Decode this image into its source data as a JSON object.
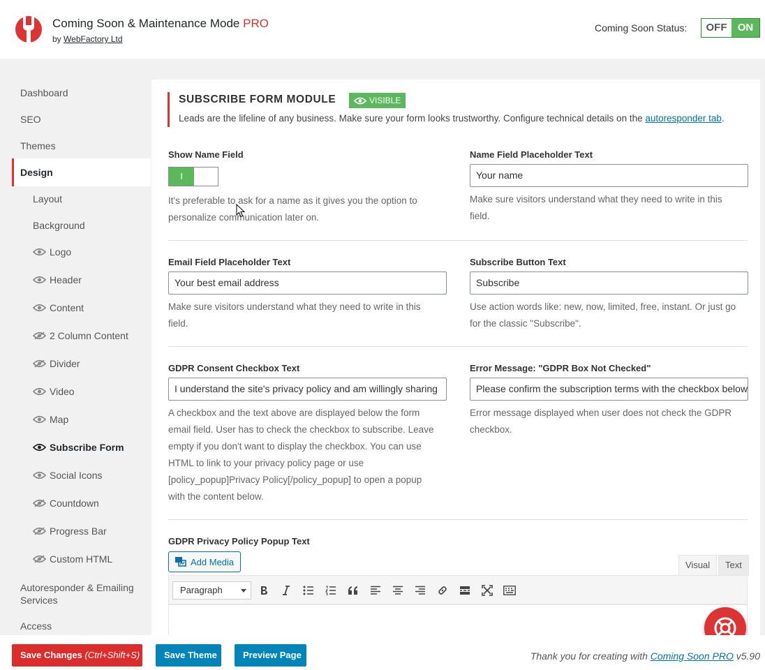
{
  "header": {
    "title": "Coming Soon & Maintenance Mode",
    "title_pro": "PRO",
    "by_prefix": "by",
    "by_link": "WebFactory Ltd",
    "status_label": "Coming Soon Status:",
    "status_off": "OFF",
    "status_on": "ON"
  },
  "sidebar": {
    "items": [
      "Dashboard",
      "SEO",
      "Themes",
      "Design"
    ],
    "design_sub": [
      {
        "label": "Layout",
        "icon": null
      },
      {
        "label": "Background",
        "icon": null
      },
      {
        "label": "Logo",
        "icon": "eye-icon"
      },
      {
        "label": "Header",
        "icon": "eye-icon"
      },
      {
        "label": "Content",
        "icon": "eye-icon"
      },
      {
        "label": "2 Column Content",
        "icon": "eye-slash-icon"
      },
      {
        "label": "Divider",
        "icon": "eye-slash-icon"
      },
      {
        "label": "Video",
        "icon": "eye-icon"
      },
      {
        "label": "Map",
        "icon": "eye-icon"
      },
      {
        "label": "Subscribe Form",
        "icon": "eye-icon"
      },
      {
        "label": "Social Icons",
        "icon": "eye-icon"
      },
      {
        "label": "Countdown",
        "icon": "eye-slash-icon"
      },
      {
        "label": "Progress Bar",
        "icon": "eye-slash-icon"
      },
      {
        "label": "Custom HTML",
        "icon": "eye-slash-icon"
      }
    ],
    "after": [
      "Autoresponder & Emailing",
      "Services",
      "Access"
    ]
  },
  "module": {
    "title": "SUBSCRIBE FORM MODULE",
    "badge": "VISIBLE",
    "desc": "Leads are the lifeline of any business. Make sure your form looks trustworthy. Configure technical details on the",
    "desc_link": "autoresponder tab",
    "desc_end": "."
  },
  "fields": {
    "show_name_label": "Show Name Field",
    "show_name_toggle": "I",
    "show_name_help_1": "It's preferable to ask for a name as it gives you the option to",
    "show_name_help_2": "personalize communication later on.",
    "name_placeholder_label": "Name Field Placeholder Text",
    "name_placeholder_value": "Your name",
    "name_placeholder_help_1": "Make sure visitors understand what they need to write in this",
    "name_placeholder_help_2": "field.",
    "email_placeholder_label": "Email Field Placeholder Text",
    "email_placeholder_value": "Your best email address",
    "email_help_1": "Make sure visitors understand what they need to write in this",
    "email_help_2": "field.",
    "button_label": "Subscribe Button Text",
    "button_value": "Subscribe",
    "button_help_1": "Use action words like: new, now, limited, free, instant. Or just go",
    "button_help_2": "for the classic \"Subscribe\".",
    "gdpr_label": "GDPR Consent Checkbox Text",
    "gdpr_value": "I understand the site's privacy policy and am willingly sharing",
    "gdpr_help": [
      "A checkbox and the text above are displayed below the form",
      "email field. User has to check the checkbox to subscribe. Leave",
      "empty if you don't want to display the checkbox. You can use",
      "HTML to link to your privacy policy page or use",
      "[policy_popup]Privacy Policy[/policy_popup] to open a popup",
      "with the content below."
    ],
    "error_label": "Error Message: \"GDPR Box Not Checked\"",
    "error_value": "Please confirm the subscription terms with the checkbox below",
    "error_help_1": "Error message displayed when user does not check the GDPR",
    "error_help_2": "checkbox.",
    "popup_label": "GDPR Privacy Policy Popup Text"
  },
  "editor": {
    "add_media": "Add Media",
    "tab_visual": "Visual",
    "tab_text": "Text",
    "format": "Paragraph"
  },
  "footer": {
    "save": "Save Changes",
    "save_shortcut": "(Ctrl+Shift+S)",
    "save_theme": "Save Theme",
    "preview": "Preview Page",
    "note_prefix": "Thank you for creating with",
    "note_link": "Coming Soon PRO",
    "note_version": "v5.90"
  },
  "colors": {
    "accent_red": "#dd3333",
    "green": "#5cb85c",
    "blue": "#0085ba"
  }
}
